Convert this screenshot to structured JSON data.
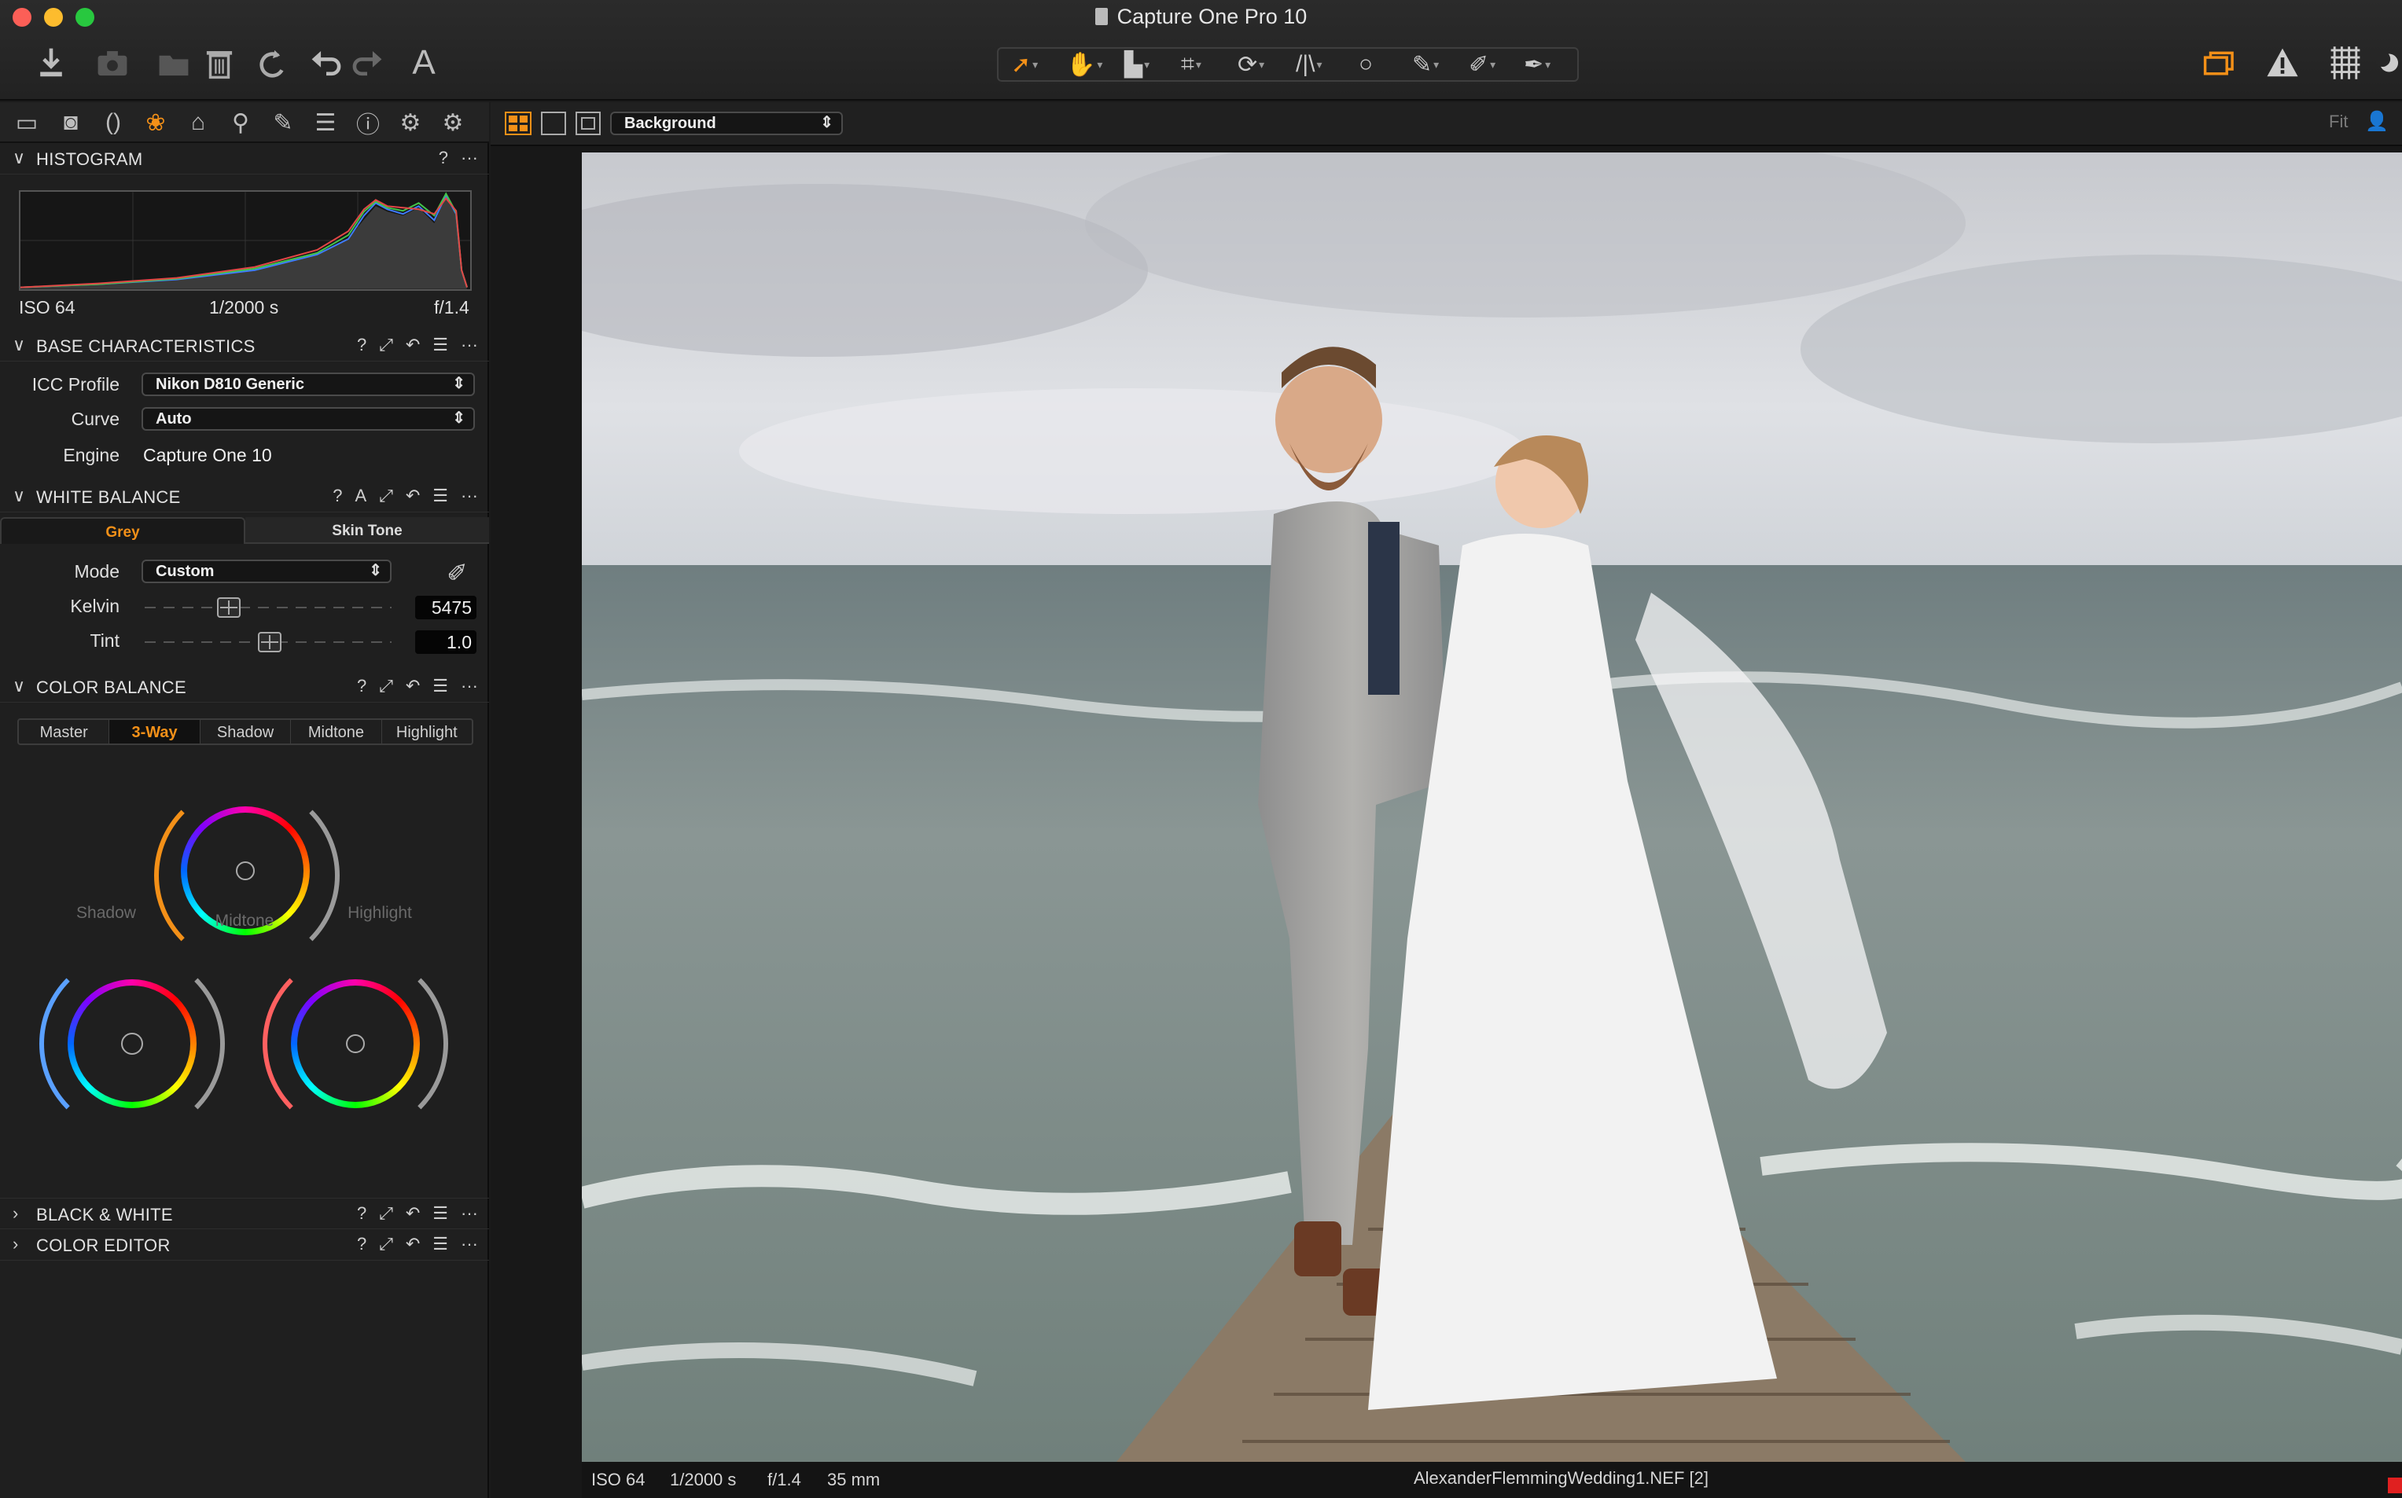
{
  "window": {
    "title": "Capture One Pro 10"
  },
  "toolbar": {
    "left_icons": [
      "import-icon",
      "camera-icon",
      "folder-move-icon",
      "trash-icon",
      "rotate-icon",
      "undo-icon",
      "redo-icon",
      "text-icon"
    ],
    "cursor_tools": [
      "select-arrow-icon",
      "hand-pan-icon",
      "loupe-icon",
      "crop-icon",
      "rotate-tool-icon",
      "keystone-icon",
      "spot-circle-icon",
      "brush-icon",
      "eyedropper-icon",
      "annotation-pen-icon"
    ],
    "right_icons": [
      "layers-icon",
      "warning-icon",
      "grid-icon",
      "moon-icon"
    ]
  },
  "sidebar": {
    "tool_tabs": [
      "folder-icon",
      "camera-tab-icon",
      "lens-icon",
      "color-icon",
      "exposure-icon",
      "search-tab-icon",
      "brush-tab-icon",
      "metadata-icon",
      "info-icon",
      "settings-icon",
      "custom-tools-icon"
    ],
    "histogram": {
      "title": "HISTOGRAM",
      "iso": "ISO 64",
      "shutter": "1/2000 s",
      "aperture": "f/1.4"
    },
    "base_characteristics": {
      "title": "BASE CHARACTERISTICS",
      "icc_label": "ICC Profile",
      "icc_value": "Nikon D810 Generic",
      "curve_label": "Curve",
      "curve_value": "Auto",
      "engine_label": "Engine",
      "engine_value": "Capture One 10"
    },
    "white_balance": {
      "title": "WHITE BALANCE",
      "tabs": [
        "Grey",
        "Skin Tone"
      ],
      "active_tab": "Grey",
      "mode_label": "Mode",
      "mode_value": "Custom",
      "kelvin_label": "Kelvin",
      "kelvin_value": "5475",
      "tint_label": "Tint",
      "tint_value": "1.0",
      "auto_label": "A"
    },
    "color_balance": {
      "title": "COLOR BALANCE",
      "tabs": [
        "Master",
        "3-Way",
        "Shadow",
        "Midtone",
        "Highlight"
      ],
      "active_tab": "3-Way",
      "wheel_labels": {
        "shadow": "Shadow",
        "midtone": "Midtone",
        "highlight": "Highlight"
      }
    },
    "collapsed_panels": [
      "BLACK & WHITE",
      "COLOR EDITOR"
    ],
    "help_mark": "?",
    "menu_mark": "···"
  },
  "viewer": {
    "variant_select": "Background",
    "zoom_label": "Fit",
    "status": {
      "iso": "ISO 64",
      "shutter": "1/2000 s",
      "aperture": "f/1.4",
      "focal": "35 mm",
      "filename": "AlexanderFlemmingWedding1.NEF [2]"
    }
  },
  "colors": {
    "accent": "#f39018",
    "traffic_red": "#fc5f57",
    "traffic_yellow": "#fdbc2e",
    "traffic_green": "#28c83f"
  }
}
